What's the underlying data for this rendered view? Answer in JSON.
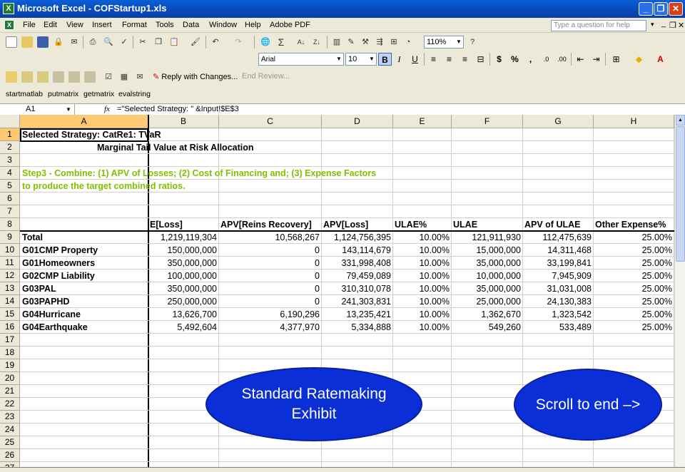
{
  "window": {
    "title": "Microsoft Excel - COFStartup1.xls",
    "app_icon": "excel-icon",
    "buttons": [
      "minimize-icon",
      "restore-icon",
      "close-icon"
    ]
  },
  "menu": {
    "items": [
      "File",
      "Edit",
      "View",
      "Insert",
      "Format",
      "Tools",
      "Data",
      "Window",
      "Help",
      "Adobe PDF"
    ],
    "ask_placeholder": "Type a question for help"
  },
  "standard_toolbar": {
    "zoom": "110%"
  },
  "formatting_toolbar": {
    "font": "Arial",
    "font_size": "10",
    "bold": "B",
    "italic": "I",
    "underline": "U",
    "currency": "$",
    "percent": "%",
    "comma": ","
  },
  "review_toolbar": {
    "reply_label": "Reply with Changes...",
    "end_review_label": "End Review..."
  },
  "matlab_toolbar": {
    "buttons": [
      "startmatlab",
      "putmatrix",
      "getmatrix",
      "evalstring"
    ]
  },
  "formula_bar": {
    "name_box": "A1",
    "fx": "fx",
    "formula": "=\"Selected Strategy: \" &Input!$E$3"
  },
  "sheet": {
    "columns": [
      "A",
      "B",
      "C",
      "D",
      "E",
      "F",
      "G",
      "H"
    ],
    "row_numbers": [
      "1",
      "2",
      "3",
      "4",
      "5",
      "6",
      "7",
      "8",
      "9",
      "10",
      "11",
      "12",
      "13",
      "14",
      "15",
      "16",
      "17",
      "18",
      "19",
      "20",
      "21",
      "22",
      "23",
      "24",
      "25",
      "26",
      "27"
    ],
    "title": "Selected Strategy: CatRe1: TVaR",
    "subtitle": "Marginal Tail Value at Risk Allocation",
    "step_line1": "Step3 - Combine: (1) APV of Losses; (2) Cost of Financing and; (3) Expense Factors",
    "step_line2": "to produce the target combined ratios.",
    "headers": [
      "E[Loss]",
      "APV[Reins Recovery]",
      "APV[Loss]",
      "ULAE%",
      "ULAE",
      "APV of ULAE",
      "Other Expense%"
    ],
    "rows": [
      [
        "Total",
        "1,219,119,304",
        "10,568,267",
        "1,124,756,395",
        "10.00%",
        "121,911,930",
        "112,475,639",
        "25.00%"
      ],
      [
        "G01CMP Property",
        "150,000,000",
        "0",
        "143,114,679",
        "10.00%",
        "15,000,000",
        "14,311,468",
        "25.00%"
      ],
      [
        "G01Homeowners",
        "350,000,000",
        "0",
        "331,998,408",
        "10.00%",
        "35,000,000",
        "33,199,841",
        "25.00%"
      ],
      [
        "G02CMP Liability",
        "100,000,000",
        "0",
        "79,459,089",
        "10.00%",
        "10,000,000",
        "7,945,909",
        "25.00%"
      ],
      [
        "G03PAL",
        "350,000,000",
        "0",
        "310,310,078",
        "10.00%",
        "35,000,000",
        "31,031,008",
        "25.00%"
      ],
      [
        "G03PAPHD",
        "250,000,000",
        "0",
        "241,303,831",
        "10.00%",
        "25,000,000",
        "24,130,383",
        "25.00%"
      ],
      [
        "G04Hurricane",
        "13,626,700",
        "6,190,296",
        "13,235,421",
        "10.00%",
        "1,362,670",
        "1,323,542",
        "25.00%"
      ],
      [
        "G04Earthquake",
        "5,492,604",
        "4,377,970",
        "5,334,888",
        "10.00%",
        "549,260",
        "533,489",
        "25.00%"
      ]
    ]
  },
  "callouts": {
    "left": "Standard Ratemaking Exhibit",
    "right": "Scroll to end –>"
  },
  "colors": {
    "titlebar": "#0848b8",
    "green_text": "#80c000",
    "callout": "#0b2fd6",
    "selected_header": "#ffc873"
  }
}
